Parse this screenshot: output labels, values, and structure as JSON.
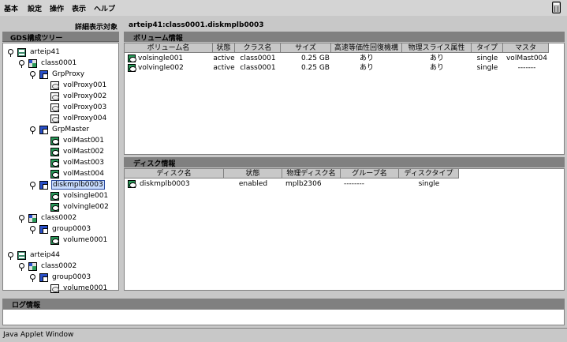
{
  "menu": [
    "基本",
    "設定",
    "操作",
    "表示",
    "ヘルプ"
  ],
  "left_caption": "詳細表示対象",
  "tree_title": "GDS構成ツリー",
  "tree": [
    {
      "label": "arteip41",
      "icon": "server-icon"
    },
    {
      "label": "class0001",
      "icon": "class-icon"
    },
    {
      "label": "GrpProxy",
      "icon": "group-icon"
    },
    {
      "label": "volProxy001",
      "icon": "disk-icon"
    },
    {
      "label": "volProxy002",
      "icon": "disk-icon"
    },
    {
      "label": "volProxy003",
      "icon": "disk-icon"
    },
    {
      "label": "volProxy004",
      "icon": "disk-icon"
    },
    {
      "label": "GrpMaster",
      "icon": "group-icon"
    },
    {
      "label": "volMast001",
      "icon": "volume-icon"
    },
    {
      "label": "volMast002",
      "icon": "volume-icon"
    },
    {
      "label": "volMast003",
      "icon": "volume-icon"
    },
    {
      "label": "volMast004",
      "icon": "volume-icon"
    },
    {
      "label": "diskmplb0003",
      "icon": "group-icon"
    },
    {
      "label": "volsingle001",
      "icon": "volume-icon"
    },
    {
      "label": "volvingle002",
      "icon": "volume-icon"
    },
    {
      "label": "class0002",
      "icon": "class-icon"
    },
    {
      "label": "group0003",
      "icon": "group-icon"
    },
    {
      "label": "volume0001",
      "icon": "volume-icon"
    },
    {
      "label": "arteip44",
      "icon": "server-icon"
    },
    {
      "label": "class0002",
      "icon": "class-icon"
    },
    {
      "label": "group0003",
      "icon": "group-icon"
    },
    {
      "label": "volume0001",
      "icon": "disk-icon"
    }
  ],
  "right_caption": "arteip41:class0001.diskmplb0003",
  "volume_section": {
    "title": "ボリューム情報",
    "columns": [
      "ボリューム名",
      "状態",
      "クラス名",
      "サイズ",
      "高速等価性回復機構",
      "物理スライス属性",
      "タイプ",
      "マスタ"
    ],
    "rows": [
      [
        "volsingle001",
        "active",
        "class0001",
        "0.25 GB",
        "あり",
        "あり",
        "single",
        "volMast004"
      ],
      [
        "volvingle002",
        "active",
        "class0001",
        "0.25 GB",
        "あり",
        "あり",
        "single",
        "-------"
      ]
    ]
  },
  "disk_section": {
    "title": "ディスク情報",
    "columns": [
      "ディスク名",
      "状態",
      "物理ディスク名",
      "グループ名",
      "ディスクタイプ"
    ],
    "rows": [
      [
        "diskmplb0003",
        "enabled",
        "mplb2306",
        "--------",
        "single"
      ]
    ]
  },
  "log_title": "ログ情報",
  "status_text": "Java Applet Window"
}
